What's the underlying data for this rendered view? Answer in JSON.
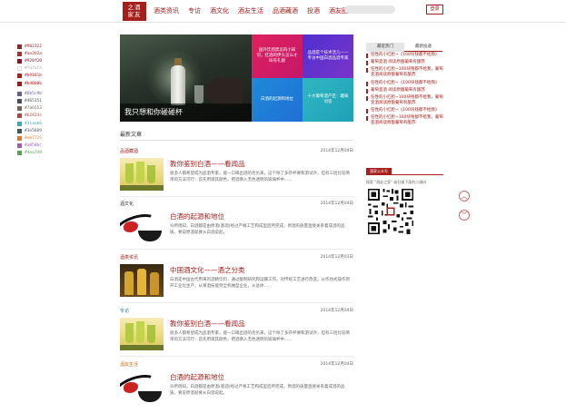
{
  "logo": {
    "line1": "之酒",
    "line2": "家友"
  },
  "nav": [
    "酒类资讯",
    "专访",
    "酒文化",
    "酒友生活",
    "品酒藏酒",
    "投酒",
    "酒友圈"
  ],
  "search": {
    "placeholder": ""
  },
  "login_label": "登录",
  "swatches": {
    "group1": [
      {
        "hex": "#982322",
        "color": "#982322"
      },
      {
        "hex": "#ae2b2a",
        "color": "#ae2b2a"
      },
      {
        "hex": "#920f20",
        "color": "#920f20"
      },
      {
        "hex": "#fafafa",
        "color": "#fafafa"
      },
      {
        "hex": "#b9181b",
        "color": "#b9181b"
      },
      {
        "hex": "#b40b0b",
        "color": "#b40b0b"
      }
    ],
    "group2": [
      {
        "hex": "#6b5c9b",
        "color": "#6b5c9b"
      },
      {
        "hex": "#465151",
        "color": "#465151"
      },
      {
        "hex": "#7a6553",
        "color": "#7a6553"
      },
      {
        "hex": "#b2423c",
        "color": "#b2423c"
      },
      {
        "hex": "#31aeb6",
        "color": "#31aeb6"
      },
      {
        "hex": "#3e5669",
        "color": "#3e5669"
      },
      {
        "hex": "#eb7725",
        "color": "#eb7725"
      },
      {
        "hex": "#a058bc",
        "color": "#a058bc"
      },
      {
        "hex": "#4ea749",
        "color": "#4ea749"
      }
    ]
  },
  "banner": {
    "caption": "我只想和你碰碰杯",
    "tiles": [
      "国外饮酒禁忌的小知识，红酒的伊头怎么才叫有礼貌",
      "品酒是个技术活儿——专访中国白酒品酒专家",
      "白酒的起源和地位",
      "十大葡萄酒产区：趣味问答"
    ]
  },
  "latest": {
    "title": "最新文章"
  },
  "articles": [
    {
      "category": "品酒藏酒",
      "cat_color": "#a5201c",
      "date": "2014年12月04日",
      "title": "教你鉴别白酒——看闻品",
      "excerpt": "很多人都希望成为品酒专家，能一口喝出酒的优劣来，这个除了多开杯要和游试外，但有三招比较简单的方法可行：首先用观其颜色，把酒倒入无色透明的玻璃杯中......",
      "thumb": "wine"
    },
    {
      "category": "酒文化",
      "cat_color": "#555555",
      "date": "2014年12月04日",
      "title": "白酒的起源和地位",
      "excerpt": "众所周知，白酒都是由原酒(基酒)经过严格工艺和成型后所完成，原酒的质量直接关系着成酒的品质。要说原酒就要从白酒说起。",
      "thumb": "splash"
    },
    {
      "category": "酒类资讯",
      "cat_color": "#a5201c",
      "date": "2014年12月03日",
      "title": "中国酒文化——酒之分类",
      "excerpt": "白酒是中国古代用来的酒精饮料，通过酿制研究和运输工作，对传统工艺进行改变，从作坊式操作到开工业化生产，从果酒技能到全机械型企业，从总体……",
      "thumb": "gold"
    },
    {
      "category": "专访",
      "cat_color": "#2a7ab0",
      "date": "2014年12月04日",
      "title": "教你鉴别白酒——看闻品",
      "excerpt": "很多人都希望成为品酒专家，能一口喝出酒的优劣来，这个除了多开杯要和游试外，但有三招比较简单的方法可行：首先用观其颜色，把酒倒入无色透明的玻璃杯中......",
      "thumb": "wine"
    },
    {
      "category": "酒友生活",
      "cat_color": "#d06a1f",
      "date": "2014年12月04日",
      "title": "白酒的起源和地位",
      "excerpt": "众所周知，白酒都是由原酒(基酒)经过严格工艺和成型后所完成，原酒的质量直接关系着成酒的品质。要说原酒就要从白酒说起。",
      "thumb": "splash"
    }
  ],
  "sidebar": {
    "tabs": [
      "最近热门",
      "最新投递"
    ],
    "hot": [
      "任性的小红脸~《100块钱都不给我》",
      "葡萄变酒 阅读原酿葡萄有酿苏",
      "任性的小红脸~100块钱都不给我，葡萄变酒阅读原酿葡萄有酿苏",
      "任性的小红脸~《100块钱都不给我》",
      "葡萄变酒 阅读原酿葡萄有酿苏",
      "任性的小红脸~100块钱都不给我，葡萄变酒阅读原酿葡萄有酿苏",
      "任性的小红脸~《100块钱都不给我》",
      "任性的小红脸~100块钱都不给我，葡萄变酒阅读原酿葡萄有酿苏"
    ],
    "qr_label": "酒家公众号",
    "qr_desc": "搜索 \"酒友之家\" 或扫描下面的二维码"
  },
  "fab": {
    "up": "︿",
    "down": "﹀"
  }
}
